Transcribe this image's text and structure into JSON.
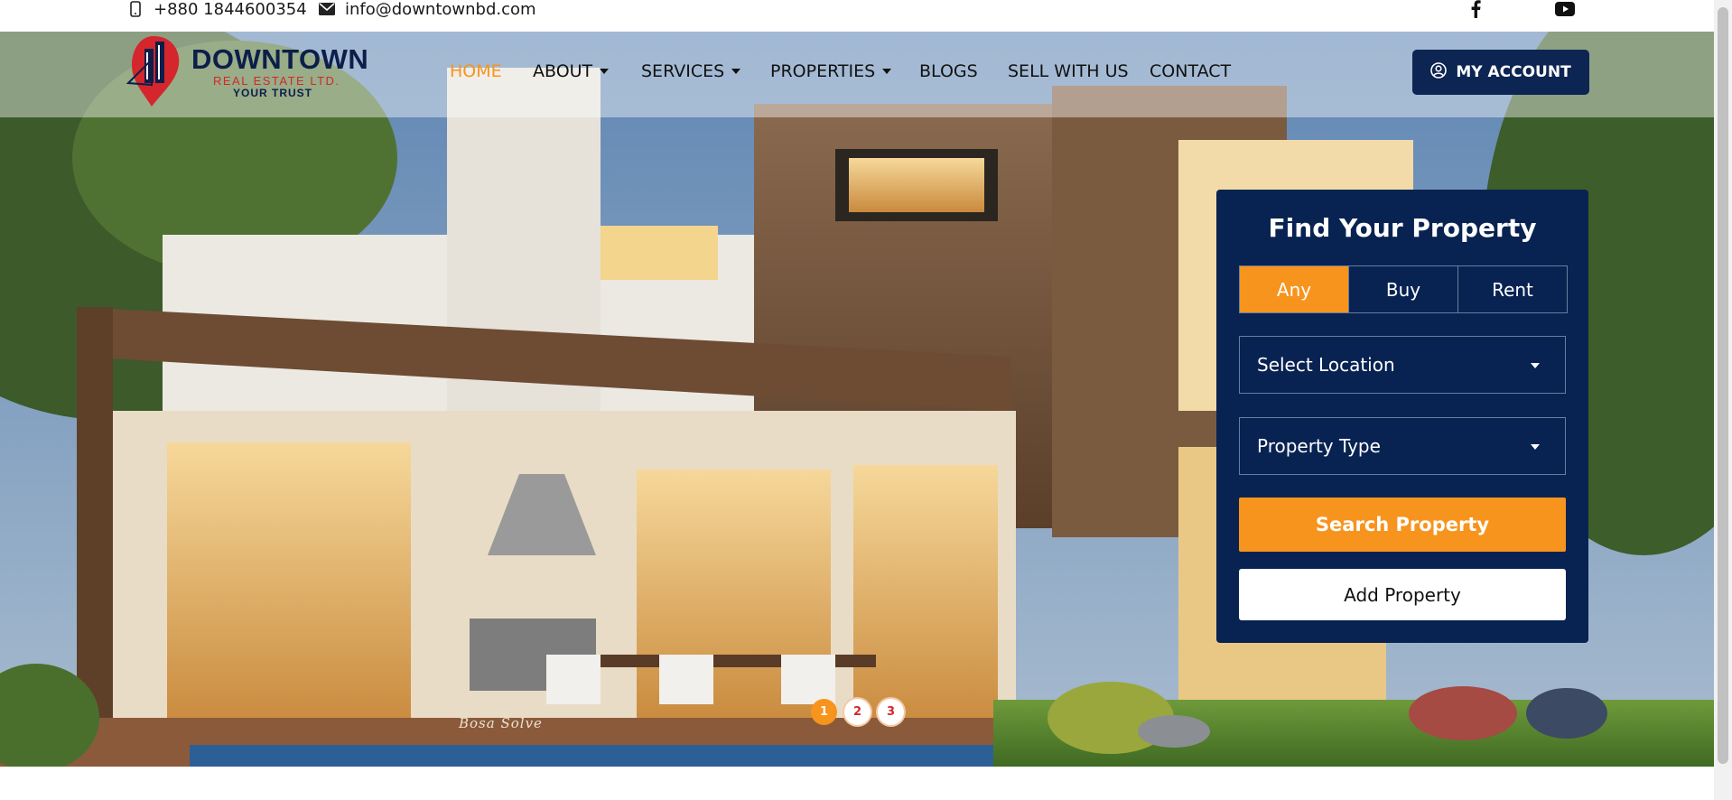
{
  "topbar": {
    "phone": "+880 1844600354",
    "phone_icon": "mobile-phone-icon",
    "email": "info@downtownbd.com",
    "email_icon": "envelope-icon",
    "social": [
      {
        "icon": "facebook-icon"
      },
      {
        "icon": "youtube-icon"
      }
    ]
  },
  "brand": {
    "name": "DOWNTOWN",
    "subtitle": "REAL ESTATE LTD.",
    "tagline": "YOUR TRUST"
  },
  "nav": {
    "items": [
      {
        "label": "HOME",
        "active": true,
        "dropdown": false
      },
      {
        "label": "ABOUT",
        "active": false,
        "dropdown": true
      },
      {
        "label": "SERVICES",
        "active": false,
        "dropdown": true
      },
      {
        "label": "PROPERTIES",
        "active": false,
        "dropdown": true
      },
      {
        "label": "BLOGS",
        "active": false,
        "dropdown": false
      },
      {
        "label": "SELL WITH US",
        "active": false,
        "dropdown": false
      },
      {
        "label": "CONTACT",
        "active": false,
        "dropdown": false
      }
    ],
    "account_label": "MY ACCOUNT",
    "account_icon": "user-circle-icon"
  },
  "search_panel": {
    "title": "Find Your Property",
    "tabs": [
      "Any",
      "Buy",
      "Rent"
    ],
    "active_tab": "Any",
    "location_select": "Select Location",
    "type_select": "Property Type",
    "search_label": "Search Property",
    "add_label": "Add Property"
  },
  "slider": {
    "pages": [
      "1",
      "2",
      "3"
    ],
    "active_page": "1"
  },
  "hero": {
    "signature": "Bosa Solve"
  },
  "colors": {
    "navy": "#082352",
    "accent": "#f7941d",
    "brand_red": "#d4262c"
  }
}
